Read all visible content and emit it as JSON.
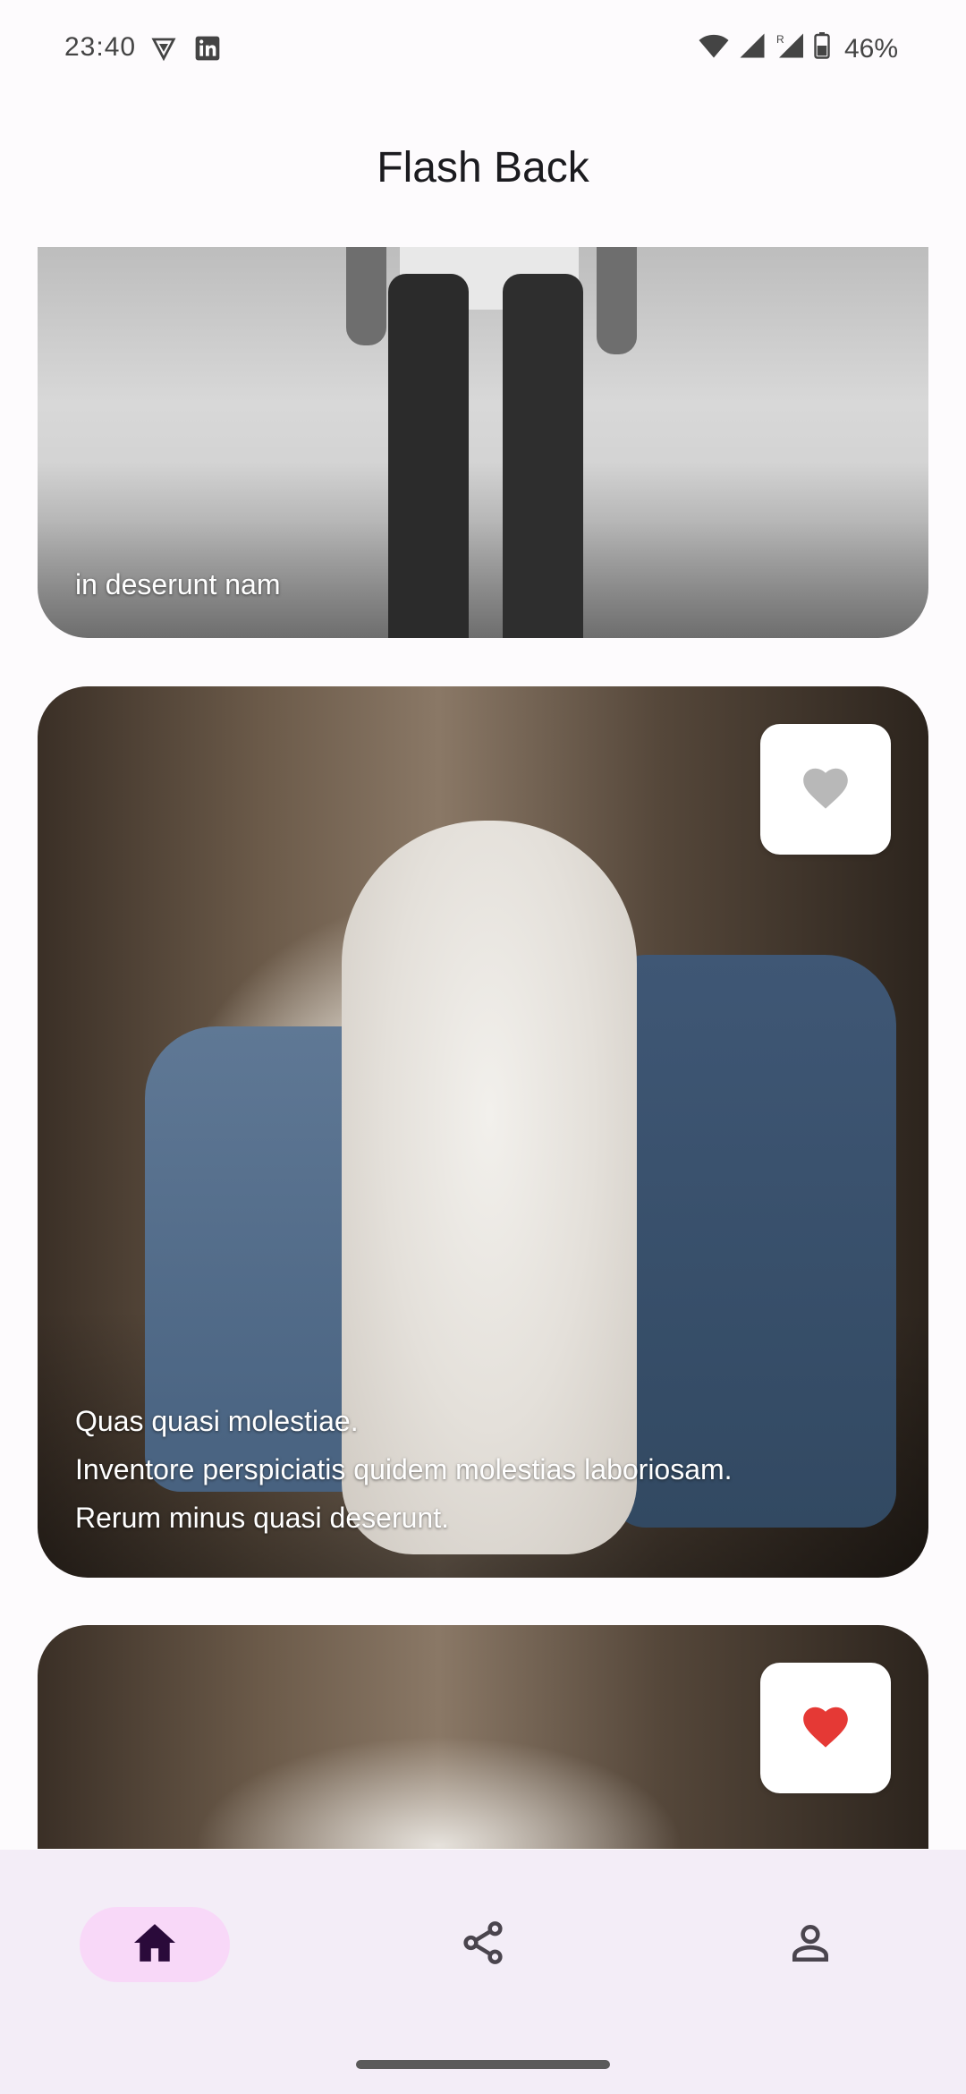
{
  "status_bar": {
    "time": "23:40",
    "battery": "46%",
    "left_icons": [
      "vpn-shield-icon",
      "linkedin-icon"
    ],
    "right_icons": [
      "wifi-icon",
      "signal-icon",
      "signal-roaming-icon",
      "battery-icon"
    ]
  },
  "header": {
    "title": "Flash Back"
  },
  "feed": {
    "cards": [
      {
        "caption_lines": [
          "in deserunt nam"
        ],
        "favorite": null
      },
      {
        "caption_lines": [
          "Quas quasi molestiae.",
          "Inventore perspiciatis quidem molestias laboriosam.",
          "Rerum minus quasi deserunt."
        ],
        "favorite": false
      },
      {
        "caption_lines": [],
        "favorite": true
      }
    ]
  },
  "bottom_nav": {
    "items": [
      {
        "icon": "home-icon",
        "active": true
      },
      {
        "icon": "share-icon",
        "active": false
      },
      {
        "icon": "person-icon",
        "active": false
      }
    ]
  },
  "colors": {
    "background": "#fdfbfd",
    "nav_background": "#f3edf7",
    "nav_active_pill": "#f8d8f8",
    "nav_active_icon": "#2a0a3a",
    "nav_icon": "#4a454e",
    "favorite_on": "#e53935",
    "favorite_off": "#b8b8b8"
  }
}
